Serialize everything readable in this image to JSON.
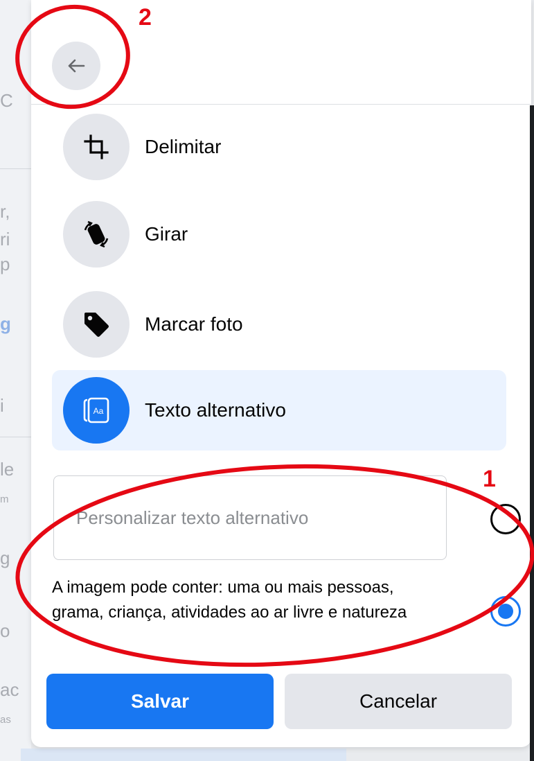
{
  "header": {
    "back_label": ""
  },
  "menu": {
    "items": [
      {
        "label": "Delimitar",
        "icon": "crop-icon",
        "active": false
      },
      {
        "label": "Girar",
        "icon": "rotate-icon",
        "active": false
      },
      {
        "label": "Marcar foto",
        "icon": "tag-icon",
        "active": false
      },
      {
        "label": "Texto alternativo",
        "icon": "alt-text-icon",
        "active": true
      }
    ]
  },
  "alt_text": {
    "custom_placeholder": "Personalizar texto alternativo",
    "custom_value": "",
    "auto_text": "A imagem pode conter: uma ou mais pessoas, grama, criança, atividades ao ar livre e natureza",
    "selected_option": "auto"
  },
  "actions": {
    "save_label": "Salvar",
    "cancel_label": "Cancelar"
  },
  "annotations": [
    {
      "number": "1",
      "target": "alt-text-options"
    },
    {
      "number": "2",
      "target": "back-button"
    }
  ],
  "colors": {
    "accent": "#1877f2",
    "active_background": "#ebf3ff",
    "icon_background": "#e4e6eb",
    "annotation": "#e50914"
  }
}
